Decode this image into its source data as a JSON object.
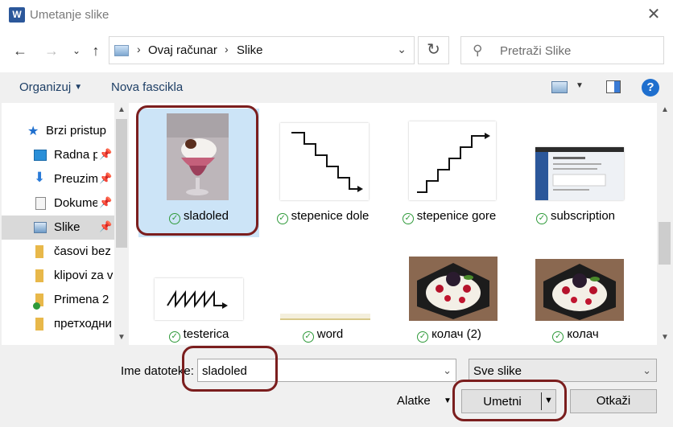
{
  "window": {
    "title": "Umetanje slike",
    "app_icon": "W"
  },
  "address": {
    "breadcrumb": [
      "Ovaj računar",
      "Slike"
    ],
    "search_placeholder": "Pretraži Slike"
  },
  "toolbar": {
    "organize_label": "Organizuj",
    "new_folder_label": "Nova fascikla",
    "help_label": "?"
  },
  "nav": {
    "items": [
      {
        "label": "Brzi pristup",
        "icon": "star-icon"
      },
      {
        "label": "Radna p",
        "icon": "desktop-icon",
        "pinned": true
      },
      {
        "label": "Preuzim",
        "icon": "download-icon",
        "pinned": true
      },
      {
        "label": "Dokume",
        "icon": "document-icon",
        "pinned": true
      },
      {
        "label": "Slike",
        "icon": "pictures-icon",
        "pinned": true,
        "selected": true
      },
      {
        "label": "časovi bez",
        "icon": "folder-icon"
      },
      {
        "label": "klipovi za v",
        "icon": "folder-icon"
      },
      {
        "label": "Primena 2",
        "icon": "folder-synced-icon"
      },
      {
        "label": "претходни",
        "icon": "folder-icon"
      }
    ]
  },
  "files": [
    {
      "name": "sladoled",
      "selected": true
    },
    {
      "name": "stepenice dole"
    },
    {
      "name": "stepenice gore"
    },
    {
      "name": "subscription"
    },
    {
      "name": "testerica"
    },
    {
      "name": "word"
    },
    {
      "name": "колач (2)"
    },
    {
      "name": "колач"
    }
  ],
  "bottom": {
    "filename_label": "Ime datoteke:",
    "filename_value": "sladoled",
    "filter_value": "Sve slike",
    "tools_label": "Alatke",
    "insert_label": "Umetni",
    "cancel_label": "Otkaži"
  },
  "colors": {
    "accent_blue": "#1f6fce",
    "highlight_ring": "#7b1e1e",
    "check_green": "#2f9a3a"
  }
}
